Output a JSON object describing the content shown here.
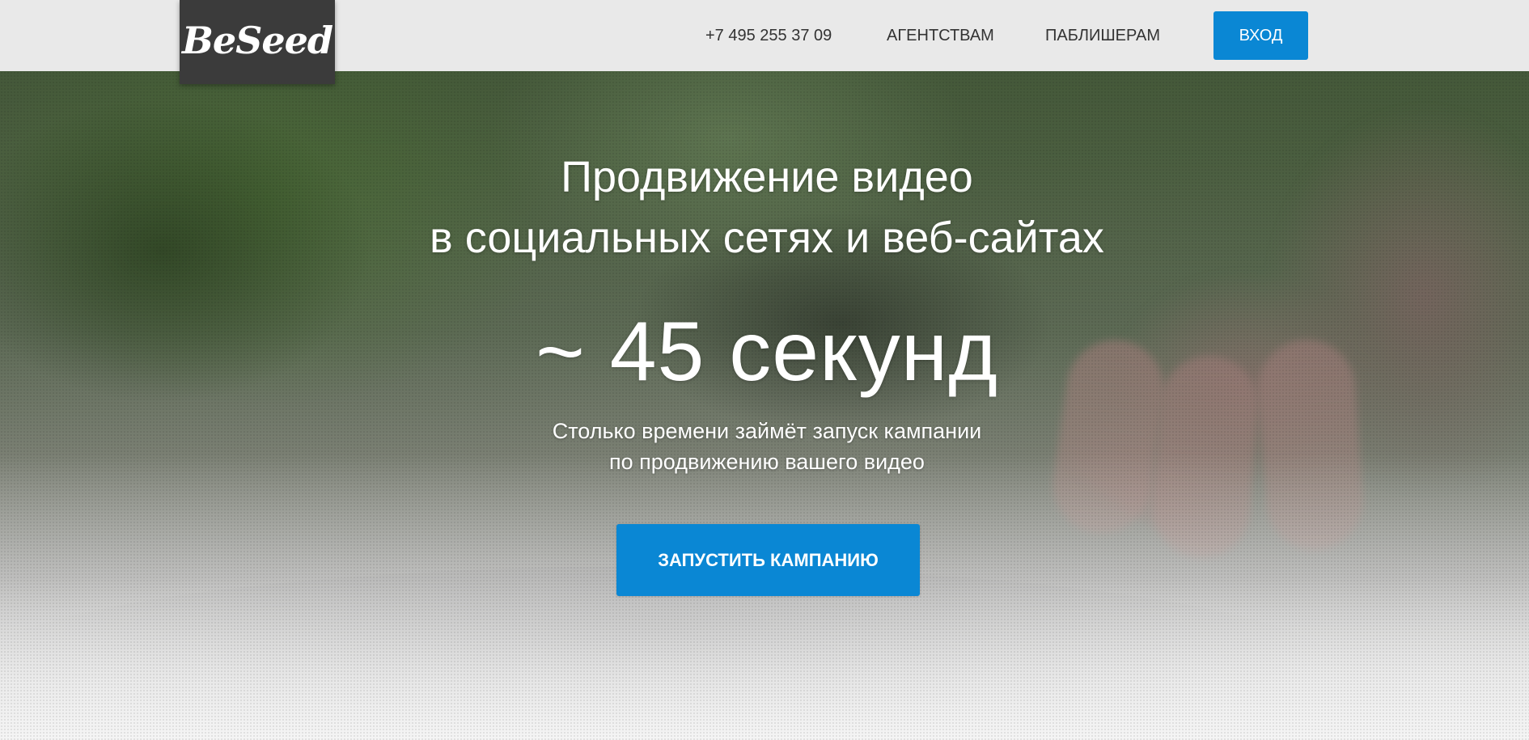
{
  "header": {
    "logo_text": "BeSeed",
    "nav": {
      "phone": "+7 495 255 37 09",
      "agencies": "АГЕНТСТВАМ",
      "publishers": "ПАБЛИШЕРАМ"
    },
    "login_label": "ВХОД"
  },
  "hero": {
    "headline_line1": "Продвижение видео",
    "headline_line2": "в социальных сетях и веб-сайтах",
    "timer": "~ 45 секунд",
    "subtext_line1": "Столько времени займёт запуск кампании",
    "subtext_line2": "по продвижению вашего видео",
    "cta_label": "ЗАПУСТИТЬ КАМПАНИЮ",
    "background_image": "hand-sowing-seed-photo"
  },
  "colors": {
    "accent": "#0a87d4",
    "header_bg": "#e9e9e9",
    "logo_bg": "#3b3b3b",
    "nav_text": "#333333"
  }
}
